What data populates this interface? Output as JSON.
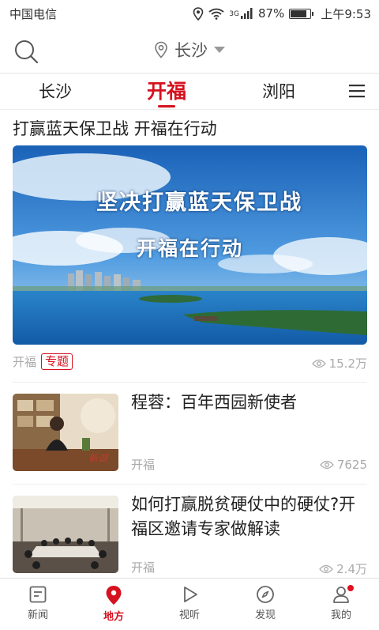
{
  "status_bar": {
    "carrier": "中国电信",
    "network": "3G",
    "battery": "87%",
    "time": "上午9:53"
  },
  "header": {
    "city": "长沙"
  },
  "tabs": [
    {
      "label": "长沙",
      "active": false
    },
    {
      "label": "开福",
      "active": true
    },
    {
      "label": "浏阳",
      "active": false
    }
  ],
  "feature": {
    "title": "打赢蓝天保卫战 开福在行动",
    "image_text_line1": "坚决打赢蓝天保卫战",
    "image_text_line2": "开福在行动",
    "source": "开福",
    "tag": "专题",
    "views": "15.2万"
  },
  "news": [
    {
      "title": "程蓉：百年西园新使者",
      "source": "开福",
      "views": "7625"
    },
    {
      "title": "如何打赢脱贫硬仗中的硬仗?开福区邀请专家做解读",
      "source": "开福",
      "views": "2.4万"
    }
  ],
  "bottom_nav": [
    {
      "label": "新闻",
      "icon": "news-icon",
      "active": false
    },
    {
      "label": "地方",
      "icon": "location-pin-icon",
      "active": true
    },
    {
      "label": "视听",
      "icon": "play-icon",
      "active": false
    },
    {
      "label": "发现",
      "icon": "compass-icon",
      "active": false
    },
    {
      "label": "我的",
      "icon": "profile-icon",
      "active": false
    }
  ],
  "colors": {
    "accent": "#d5121f",
    "text": "#222222",
    "muted": "#aaaaaa"
  }
}
